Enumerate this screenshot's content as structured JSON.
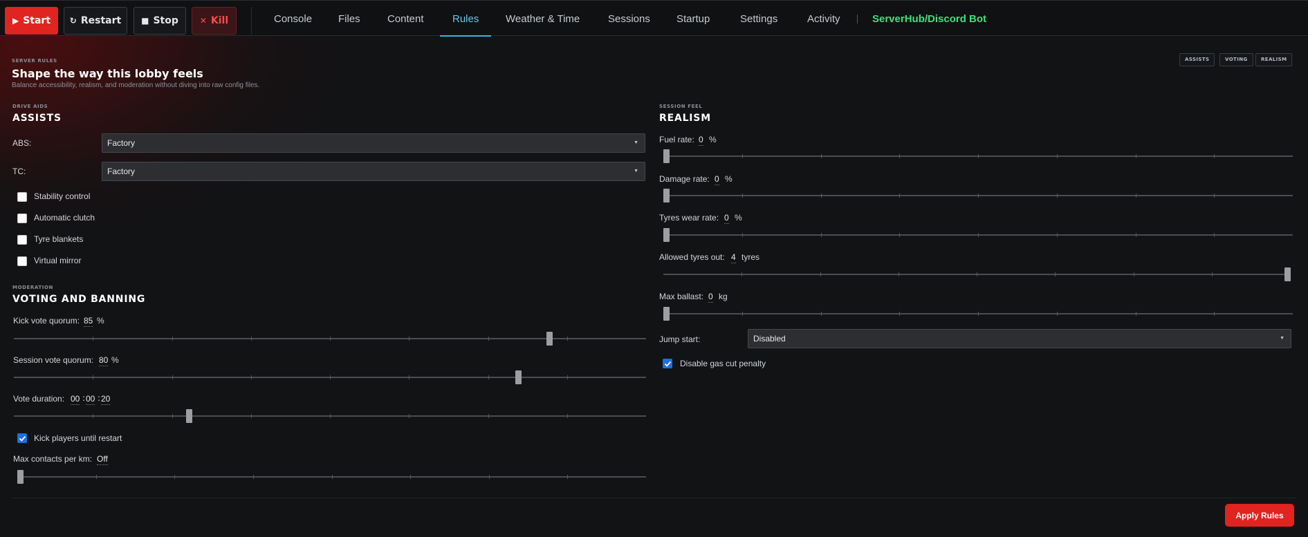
{
  "power": {
    "start": "Start",
    "restart": "Restart",
    "stop": "Stop",
    "kill": "Kill"
  },
  "tabs": [
    "Console",
    "Files",
    "Content",
    "Rules",
    "Weather & Time",
    "Sessions",
    "Startup",
    "Settings",
    "Activity"
  ],
  "active_tab": "Rules",
  "external_link": "ServerHub/Discord Bot",
  "header": {
    "kicker": "SERVER RULES",
    "title": "Shape the way this lobby feels",
    "subtitle": "Balance accessibility, realism, and moderation without diving into raw config files.",
    "chips": [
      "ASSISTS",
      "VOTING",
      "REALISM"
    ]
  },
  "assists": {
    "kicker": "DRIVE AIDS",
    "title": "ASSISTS",
    "abs_label": "ABS:",
    "abs_value": "Factory",
    "tc_label": "TC:",
    "tc_value": "Factory",
    "checkboxes": [
      {
        "label": "Stability control",
        "checked": false
      },
      {
        "label": "Automatic clutch",
        "checked": false
      },
      {
        "label": "Tyre blankets",
        "checked": false
      },
      {
        "label": "Virtual mirror",
        "checked": false
      }
    ]
  },
  "voting": {
    "kicker": "MODERATION",
    "title": "VOTING AND BANNING",
    "kick_quorum_label": "Kick vote quorum:",
    "kick_quorum_value": "85",
    "kick_quorum_unit": "%",
    "kick_quorum_level": 0.85,
    "session_quorum_label": "Session vote quorum:",
    "session_quorum_value": "80",
    "session_quorum_unit": "%",
    "session_quorum_level": 0.8,
    "vote_duration_label": "Vote duration:",
    "vote_duration_h": "00",
    "vote_duration_m": "00",
    "vote_duration_s": "20",
    "vote_duration_level": 0.275,
    "kick_until_restart_label": "Kick players until restart",
    "kick_until_restart_checked": true,
    "max_contacts_label": "Max contacts per km:",
    "max_contacts_value": "Off",
    "max_contacts_level": 0.0
  },
  "realism": {
    "kicker": "SESSION FEEL",
    "title": "REALISM",
    "fuel_label": "Fuel rate:",
    "fuel_value": "0",
    "fuel_unit": "%",
    "fuel_level": 0.0,
    "damage_label": "Damage rate:",
    "damage_value": "0",
    "damage_unit": "%",
    "damage_level": 0.0,
    "tyres_wear_label": "Tyres wear rate:",
    "tyres_wear_value": "0",
    "tyres_wear_unit": "%",
    "tyres_wear_level": 0.0,
    "tyres_out_label": "Allowed tyres out:",
    "tyres_out_value": "4",
    "tyres_out_unit": "tyres",
    "tyres_out_level": 1.0,
    "ballast_label": "Max ballast:",
    "ballast_value": "0",
    "ballast_unit": "kg",
    "ballast_level": 0.0,
    "jump_start_label": "Jump start:",
    "jump_start_value": "Disabled",
    "gas_cut_label": "Disable gas cut penalty",
    "gas_cut_checked": true
  },
  "apply_label": "Apply Rules",
  "colors": {
    "accent_red": "#e0241f",
    "tab_active": "#63c8e6",
    "link_green": "#3fe07a",
    "checkbox_blue": "#1e6fe0"
  }
}
